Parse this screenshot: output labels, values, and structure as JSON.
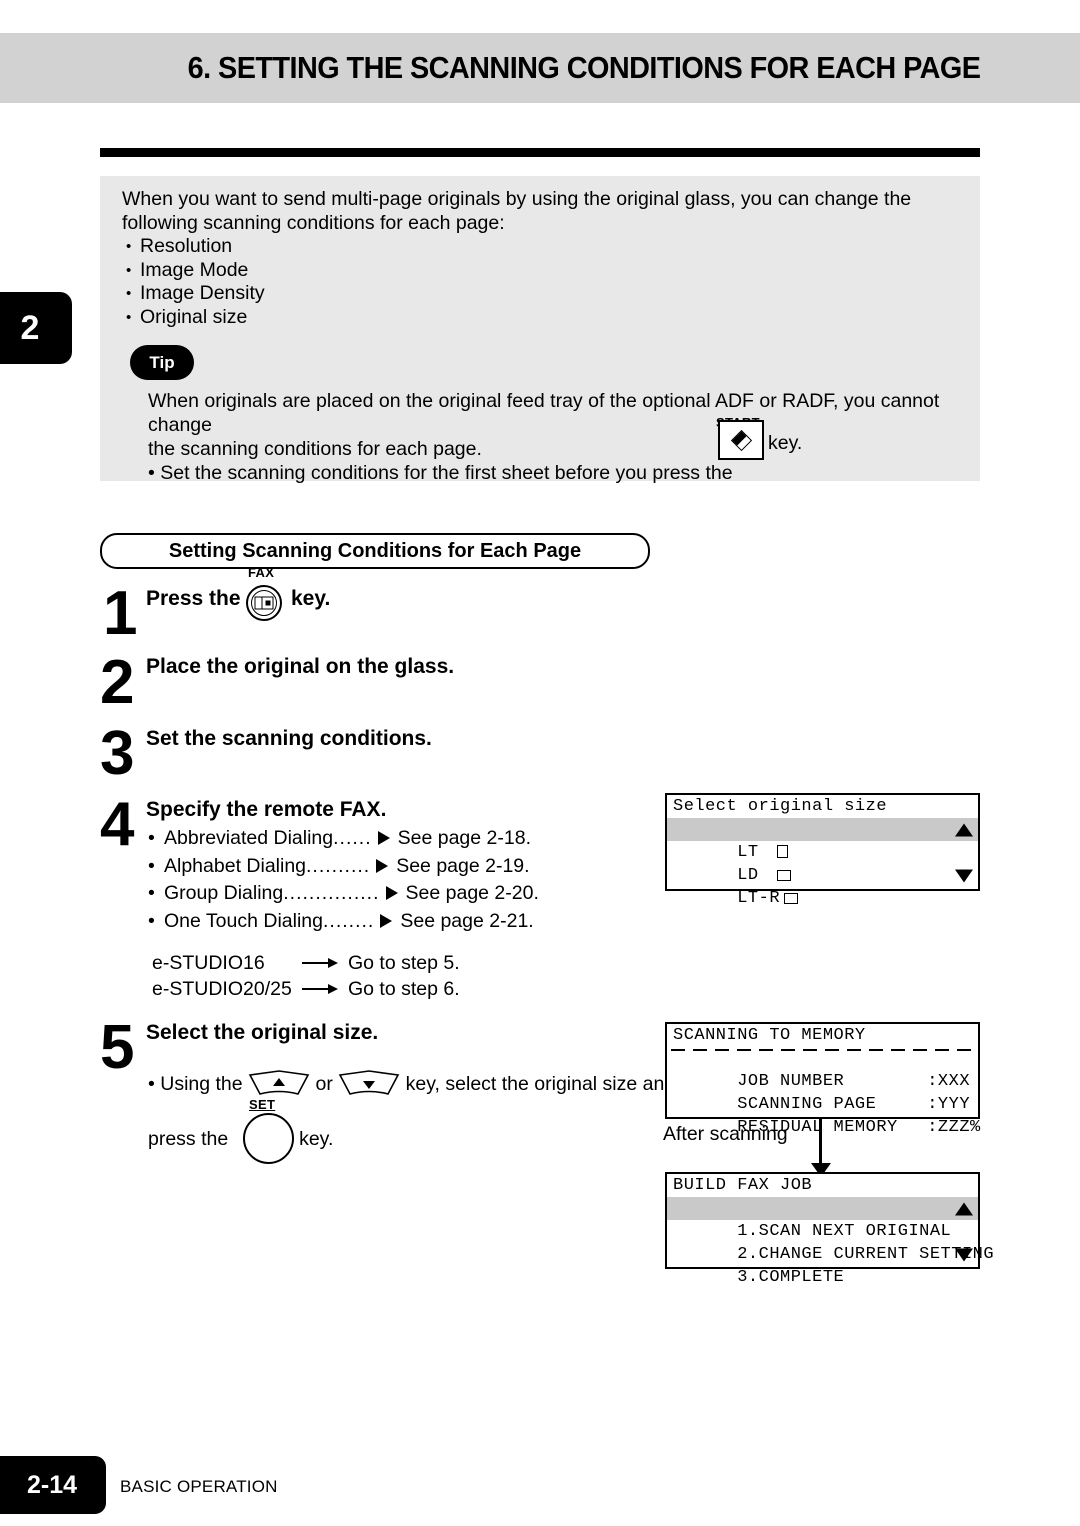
{
  "header": {
    "title": "6. SETTING THE SCANNING CONDITIONS FOR EACH PAGE"
  },
  "chapter_tab": "2",
  "intro": {
    "paragraph": "When you want to send multi-page originals by using the original glass, you can change the following scanning conditions for each page:",
    "bullets": [
      "Resolution",
      "Image Mode",
      "Image Density",
      "Original size"
    ]
  },
  "tip": {
    "badge": "Tip",
    "line1": "When originals are placed on the original feed tray of the optional ADF or RADF, you cannot change",
    "line2": "the scanning conditions for each page.",
    "line3_prefix": "• Set the scanning conditions for the first sheet before you press the",
    "start_key_label": "START",
    "line3_suffix": "key."
  },
  "section": {
    "pill_title": "Setting Scanning Conditions for Each Page"
  },
  "steps": [
    {
      "num": "1",
      "title_prefix": "Press the",
      "fax_key_label": "FAX",
      "title_suffix": "key."
    },
    {
      "num": "2",
      "title": "Place the original on the glass."
    },
    {
      "num": "3",
      "title": "Set the scanning conditions."
    },
    {
      "num": "4",
      "title": "Specify the remote FAX."
    },
    {
      "num": "5",
      "title": "Select the original size."
    }
  ],
  "dial_options": [
    {
      "name": "Abbreviated Dialing",
      "dots": "......",
      "ref": "See page 2-18."
    },
    {
      "name": "Alphabet Dialing",
      "dots": "..........",
      "ref": "See page 2-19."
    },
    {
      "name": "Group Dialing",
      "dots": "...............",
      "ref": "See page 2-20."
    },
    {
      "name": "One Touch Dialing",
      "dots": "........",
      "ref": "See page 2-21."
    }
  ],
  "model_routes": [
    {
      "model": "e-STUDIO16",
      "target": "Go to step 5."
    },
    {
      "model": "e-STUDIO20/25",
      "target": "Go to step 6."
    }
  ],
  "step5_instruction": {
    "line1_a": "• Using the",
    "line1_b": "or",
    "line1_c": "key, select the original size and",
    "line2_a": "press the",
    "set_key_label": "SET",
    "line2_b": "key."
  },
  "lcd_original_size": {
    "title": "Select original size",
    "rows": [
      {
        "label": "LT",
        "mark": "portrait",
        "selected": true,
        "caret": "up"
      },
      {
        "label": "LD",
        "mark": "landscape",
        "selected": false,
        "caret": ""
      },
      {
        "label": "LT-R",
        "mark": "landscape",
        "selected": false,
        "caret": "down"
      }
    ]
  },
  "lcd_scanning": {
    "title": "SCANNING TO MEMORY",
    "rows": [
      {
        "label": "JOB NUMBER",
        "value": ":XXX"
      },
      {
        "label": "SCANNING PAGE",
        "value": ":YYY"
      },
      {
        "label": "RESIDUAL MEMORY",
        "value": ":ZZZ%"
      }
    ]
  },
  "flow_label": "After scanning",
  "lcd_build_fax_job": {
    "title": "BUILD FAX JOB",
    "rows": [
      {
        "label": "1.SCAN NEXT ORIGINAL",
        "selected": true,
        "caret": "up"
      },
      {
        "label": "2.CHANGE CURRENT SETTING",
        "selected": false,
        "caret": ""
      },
      {
        "label": "3.COMPLETE",
        "selected": false,
        "caret": "down"
      }
    ]
  },
  "footer": {
    "page_number": "2-14",
    "section_name": "BASIC OPERATION"
  },
  "colors": {
    "header_band": "#d2d2d2",
    "panel": "#e8e8e8",
    "lcd_selected": "#c9c9c9",
    "ink": "#000000"
  }
}
